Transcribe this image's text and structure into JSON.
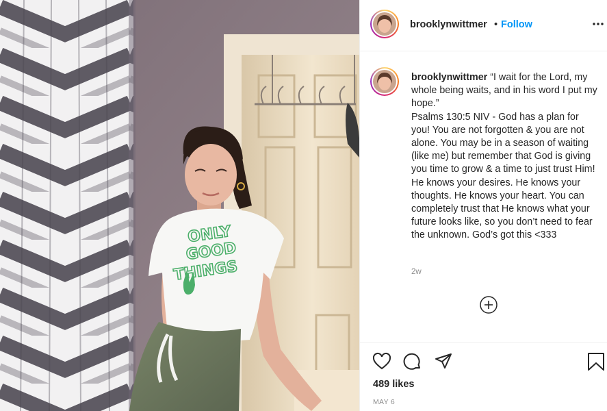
{
  "header": {
    "username": "brooklynwittmer",
    "separator": "•",
    "follow_label": "Follow",
    "more_icon": "more-horizontal-icon"
  },
  "caption": {
    "username": "brooklynwittmer",
    "lines": [
      "“I wait for the Lord, my whole being waits, and in his word I put my hope.”",
      "Psalms 130:5 NIV - God has a plan for you! You are not forgotten & you are not alone. You may be in a season of waiting (like me) but remember that God is giving you time to grow & a time to just trust Him! He knows your desires. He knows your thoughts. He knows your heart. You can completely trust that He knows what your future looks like, so you don’t need to fear the unknown. God’s got this <333"
    ],
    "time_ago": "2w"
  },
  "load_more_icon": "plus-circle-icon",
  "actions": {
    "icons": [
      "heart-icon",
      "comment-icon",
      "share-icon",
      "bookmark-icon"
    ],
    "likes": "489 likes",
    "date": "MAY 6"
  },
  "photo": {
    "shirt_text": [
      "ONLY",
      "GOOD",
      "THINGS"
    ],
    "colors": {
      "wall": "#8e7f86",
      "door": "#e9dcc4",
      "shirt": "#f7f7f5",
      "shirt_print": "#4caf6a",
      "pants": "#6f7a62",
      "hair": "#2b1d17",
      "skin": "#e8b8a2"
    }
  }
}
